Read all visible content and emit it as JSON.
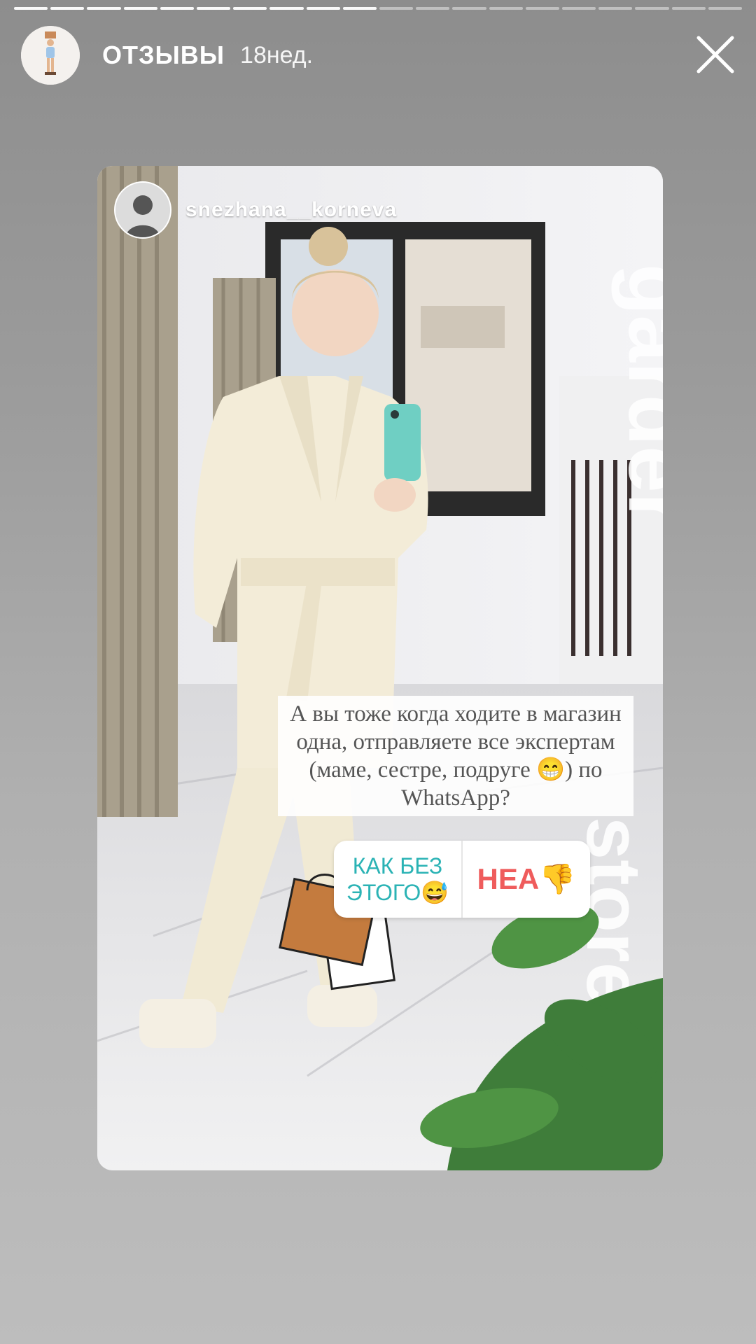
{
  "story": {
    "account_name": "ОТЗЫВЫ",
    "time_ago": "18нед.",
    "progress": {
      "segments": 20,
      "completed": 10
    }
  },
  "card": {
    "username": "snezhana__korneva",
    "question_text": "А вы тоже когда ходите в магазин одна, отправляете все экспертам (маме, сестре, подруге 😁) по WhatsApp?",
    "poll": {
      "option_a": "КАК БЕЗ ЭТОГО😅",
      "option_b": "НЕА👎"
    }
  },
  "icons": {
    "close": "close-icon",
    "avatar": "profile-avatar-icon"
  }
}
